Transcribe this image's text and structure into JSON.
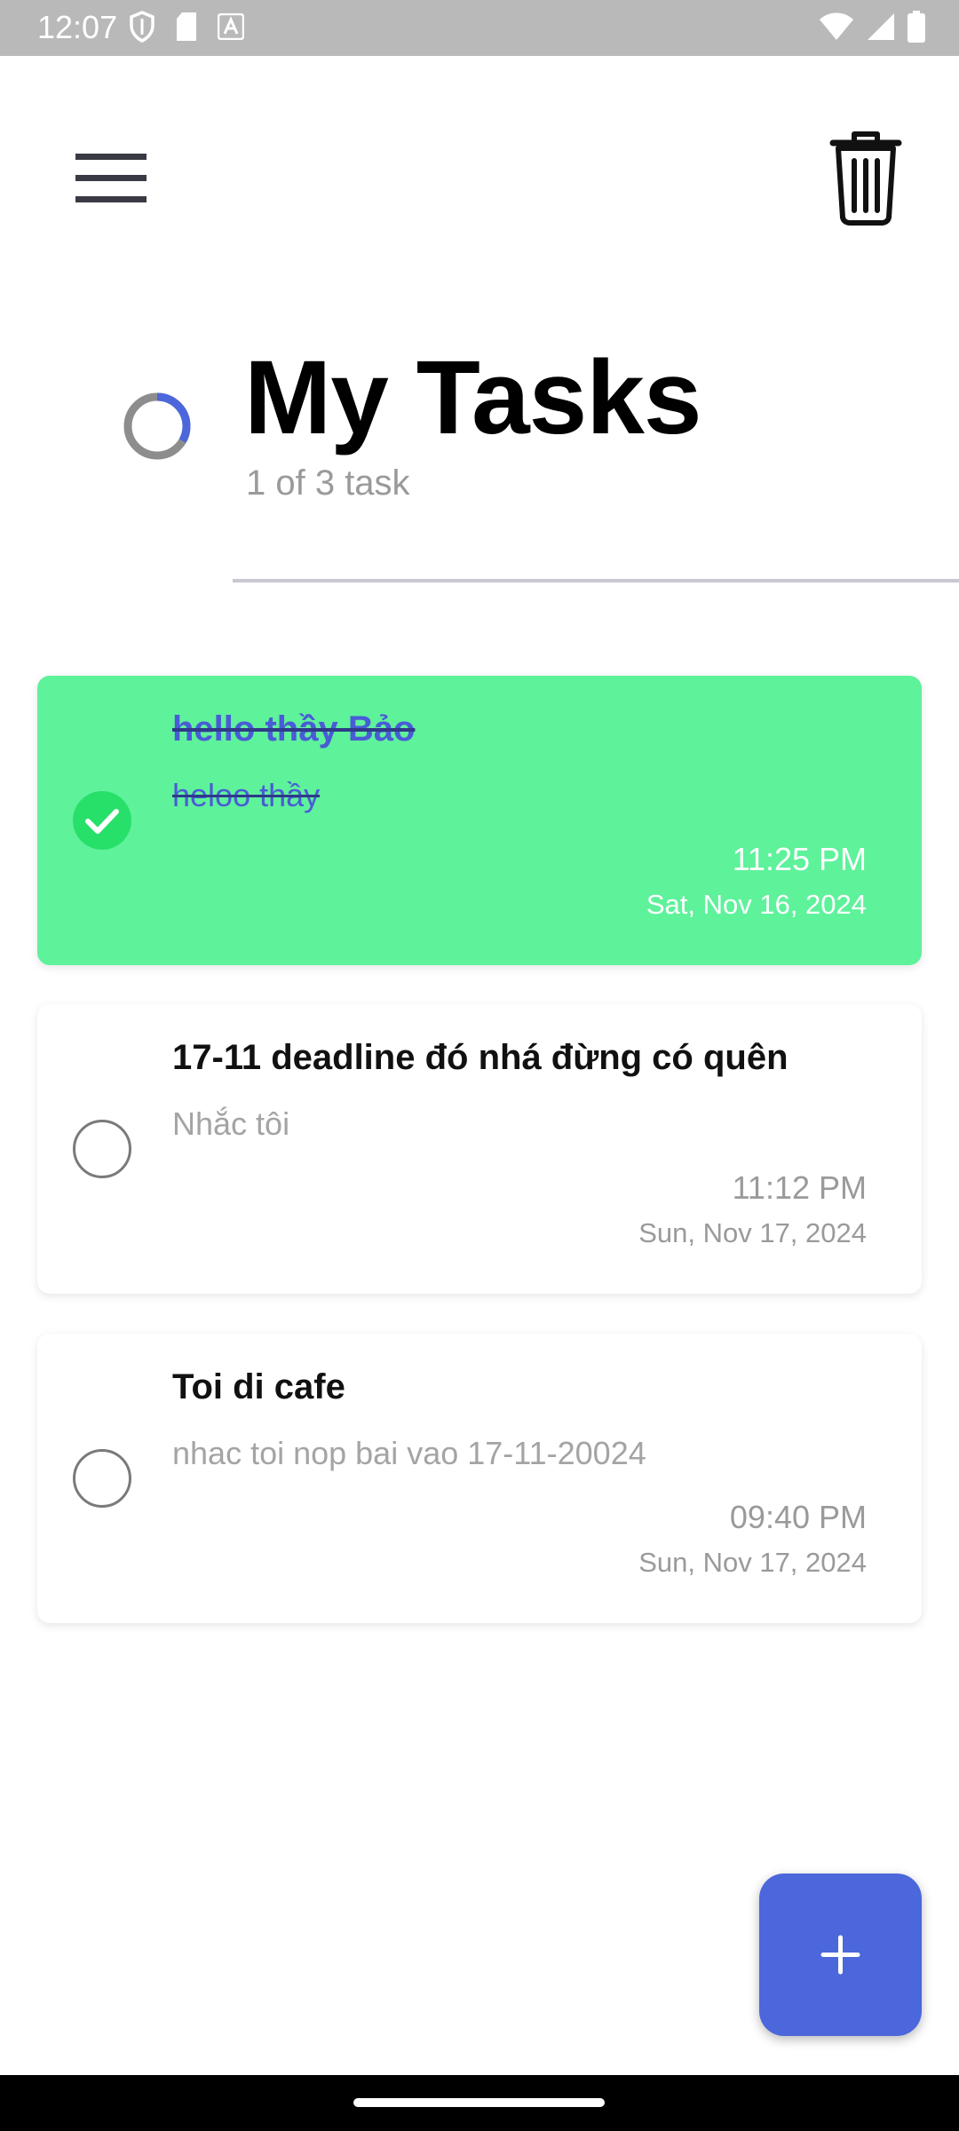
{
  "status_bar": {
    "time": "12:07",
    "icons": [
      "shield-icon",
      "sd-card-icon",
      "font-a-icon",
      "wifi-icon",
      "signal-icon",
      "battery-icon"
    ]
  },
  "header": {
    "menu_icon": "hamburger-menu-icon",
    "trash_icon": "trash-icon"
  },
  "summary": {
    "title": "My Tasks",
    "subtitle": "1 of 3 task",
    "progress": 0.3333
  },
  "tasks": [
    {
      "title": "hello thầy Bảo",
      "note": "heloo thầy",
      "time": "11:25 PM",
      "date": "Sat, Nov 16, 2024",
      "done": true
    },
    {
      "title": "17-11 deadline đó nhá đừng có quên",
      "note": "Nhắc tôi",
      "time": "11:12 PM",
      "date": "Sun, Nov 17, 2024",
      "done": false
    },
    {
      "title": "Toi di cafe",
      "note": "nhac toi nop bai vao 17-11-20024",
      "time": "09:40 PM",
      "date": "Sun, Nov 17, 2024",
      "done": false
    }
  ],
  "fab": {
    "icon": "plus-icon"
  },
  "colors": {
    "accent": "#4b67db",
    "done_card": "#5ef29b",
    "check_green": "#27e06a",
    "status_bar": "#b9b9b9"
  }
}
